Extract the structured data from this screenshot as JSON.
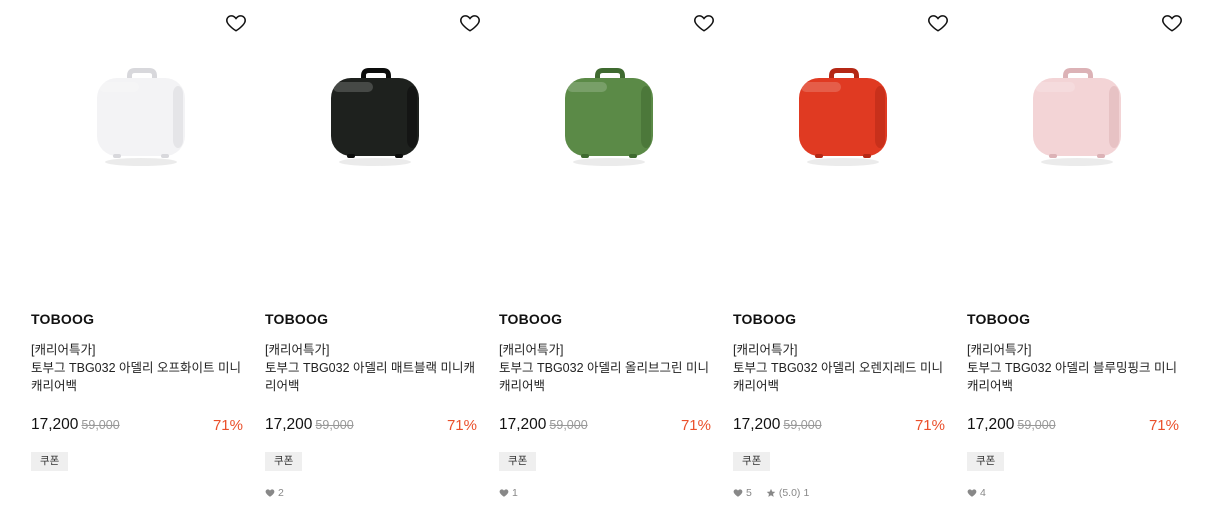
{
  "products": [
    {
      "brand": "TOBOOG",
      "tag": "[캐리어특가]",
      "title": "토부그 TBG032 아델리 오프화이트 미니캐리어백",
      "price": "17,200",
      "original_price": "59,000",
      "discount": "71%",
      "coupon": "쿠폰",
      "likes": "",
      "rating": "",
      "reviews": "",
      "color": "#f3f3f5",
      "shade": "#d8d8dc"
    },
    {
      "brand": "TOBOOG",
      "tag": "[캐리어특가]",
      "title": "토부그 TBG032 아델리 매트블랙 미니캐리어백",
      "price": "17,200",
      "original_price": "59,000",
      "discount": "71%",
      "coupon": "쿠폰",
      "likes": "2",
      "rating": "",
      "reviews": "",
      "color": "#1e211e",
      "shade": "#0c0d0c"
    },
    {
      "brand": "TOBOOG",
      "tag": "[캐리어특가]",
      "title": "토부그 TBG032 아델리 올리브그린 미니캐리어백",
      "price": "17,200",
      "original_price": "59,000",
      "discount": "71%",
      "coupon": "쿠폰",
      "likes": "1",
      "rating": "",
      "reviews": "",
      "color": "#5b8a47",
      "shade": "#3f6a30"
    },
    {
      "brand": "TOBOOG",
      "tag": "[캐리어특가]",
      "title": "토부그 TBG032 아델리 오렌지레드 미니캐리어백",
      "price": "17,200",
      "original_price": "59,000",
      "discount": "71%",
      "coupon": "쿠폰",
      "likes": "5",
      "rating": "(5.0)",
      "reviews": "1",
      "color": "#e03a22",
      "shade": "#b52815"
    },
    {
      "brand": "TOBOOG",
      "tag": "[캐리어특가]",
      "title": "토부그 TBG032 아델리 블루밍핑크 미니캐리어백",
      "price": "17,200",
      "original_price": "59,000",
      "discount": "71%",
      "coupon": "쿠폰",
      "likes": "4",
      "rating": "",
      "reviews": "",
      "color": "#f3d4d6",
      "shade": "#dcb2b6"
    }
  ],
  "icons": {
    "wishlist": "heart-outline-icon",
    "likes": "heart-filled-icon",
    "rating": "star-icon"
  },
  "colors": {
    "discount": "#ea4f2a",
    "coupon_bg": "#efefef"
  }
}
